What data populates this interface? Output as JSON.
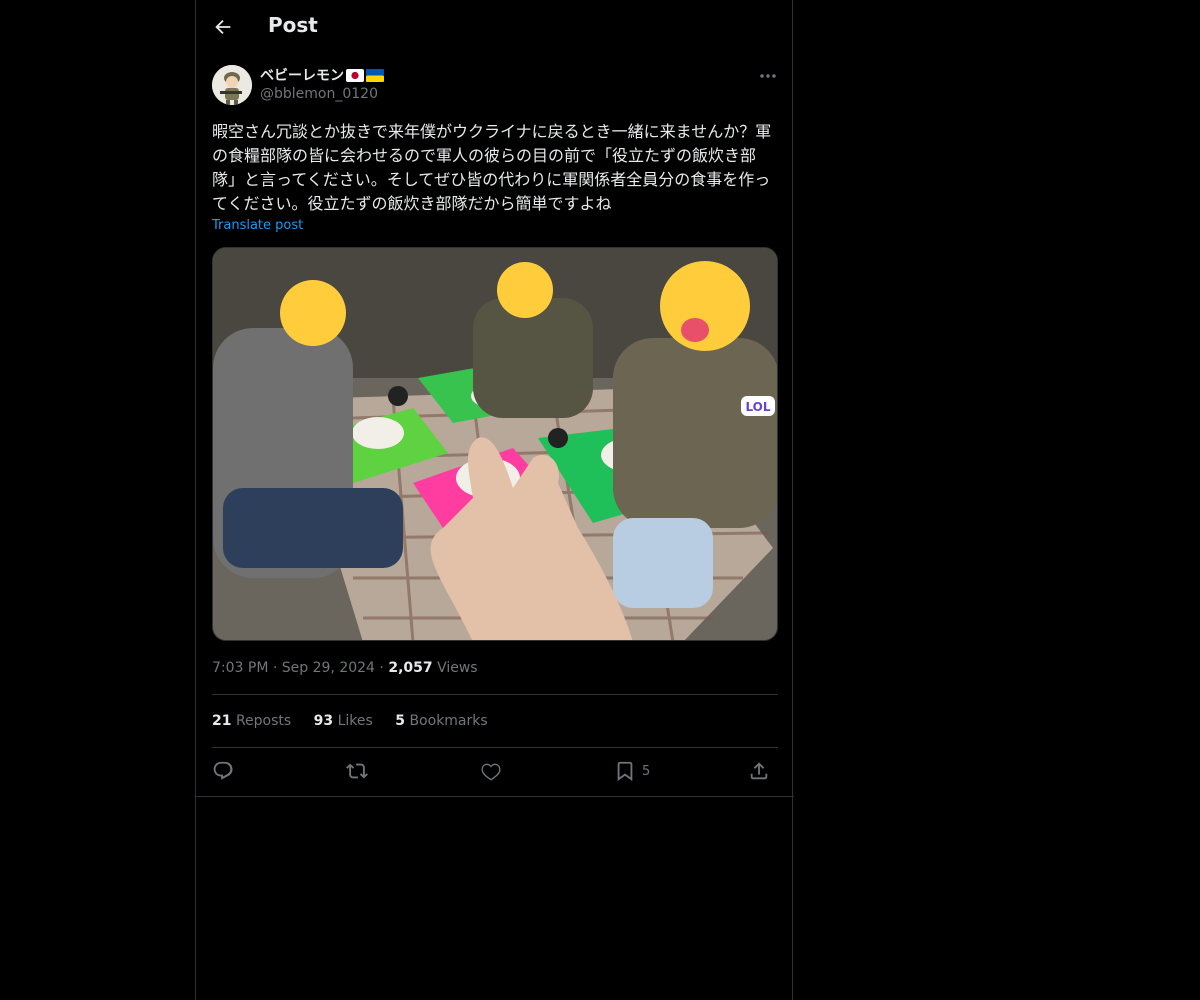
{
  "header": {
    "back_icon": "arrow-left-icon",
    "title": "Post"
  },
  "author": {
    "display_name": "ベビーレモン",
    "flags": [
      "japan-flag",
      "ukraine-flag"
    ],
    "handle": "@bblemon_0120",
    "avatar_icon": "soldier-avatar"
  },
  "tweet": {
    "text": "暇空さん冗談とか抜きで来年僕がウクライナに戻るとき一緒に来ませんか？軍の食糧部隊の皆に会わせるので軍人の彼らの目の前で「役立たずの飯炊き部隊」と言ってください。そしてぜひ皆の代わりに軍関係者全員分の食事を作ってください。役立たずの飯炊き部隊だから簡単ですよね",
    "translate_label": "Translate post",
    "media_sticker": "LOL"
  },
  "meta": {
    "time": "7:03 PM",
    "date": "Sep 29, 2024",
    "views_count": "2,057",
    "views_label": "Views"
  },
  "stats": {
    "reposts_count": "21",
    "reposts_label": "Reposts",
    "likes_count": "93",
    "likes_label": "Likes",
    "bookmarks_count": "5",
    "bookmarks_label": "Bookmarks"
  },
  "actions": {
    "reply_icon": "reply-icon",
    "repost_icon": "repost-icon",
    "like_icon": "heart-icon",
    "bookmark_icon": "bookmark-icon",
    "bookmark_count": "5",
    "share_icon": "share-icon"
  },
  "colors": {
    "background": "#000000",
    "border": "#2f3336",
    "text": "#e7e9ea",
    "muted": "#71767b",
    "link": "#1d9bf0"
  }
}
